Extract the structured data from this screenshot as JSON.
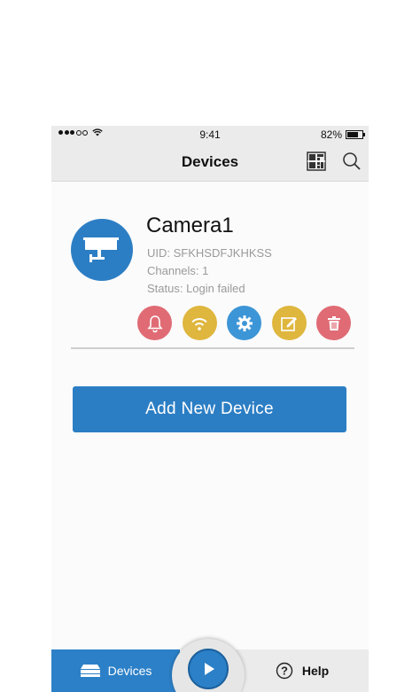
{
  "status_bar": {
    "time": "9:41",
    "battery": "82%"
  },
  "header": {
    "title": "Devices"
  },
  "device": {
    "name": "Camera1",
    "uid": "UID: SFKHSDFJKHKSS",
    "channels": "Channels: 1",
    "status": "Status: Login failed"
  },
  "actions": [
    {
      "icon": "bell-icon",
      "color": "#e06b74"
    },
    {
      "icon": "wifi-icon",
      "color": "#dfb63e"
    },
    {
      "icon": "gear-icon",
      "color": "#3c95d6"
    },
    {
      "icon": "edit-icon",
      "color": "#dfb63e"
    },
    {
      "icon": "trash-icon",
      "color": "#e06b74"
    }
  ],
  "add_button": {
    "label": "Add New Device"
  },
  "tabbar": {
    "devices_label": "Devices",
    "help_label": "Help"
  },
  "colors": {
    "primary": "#2c7ec4",
    "bar_gray": "#ebebeb"
  }
}
